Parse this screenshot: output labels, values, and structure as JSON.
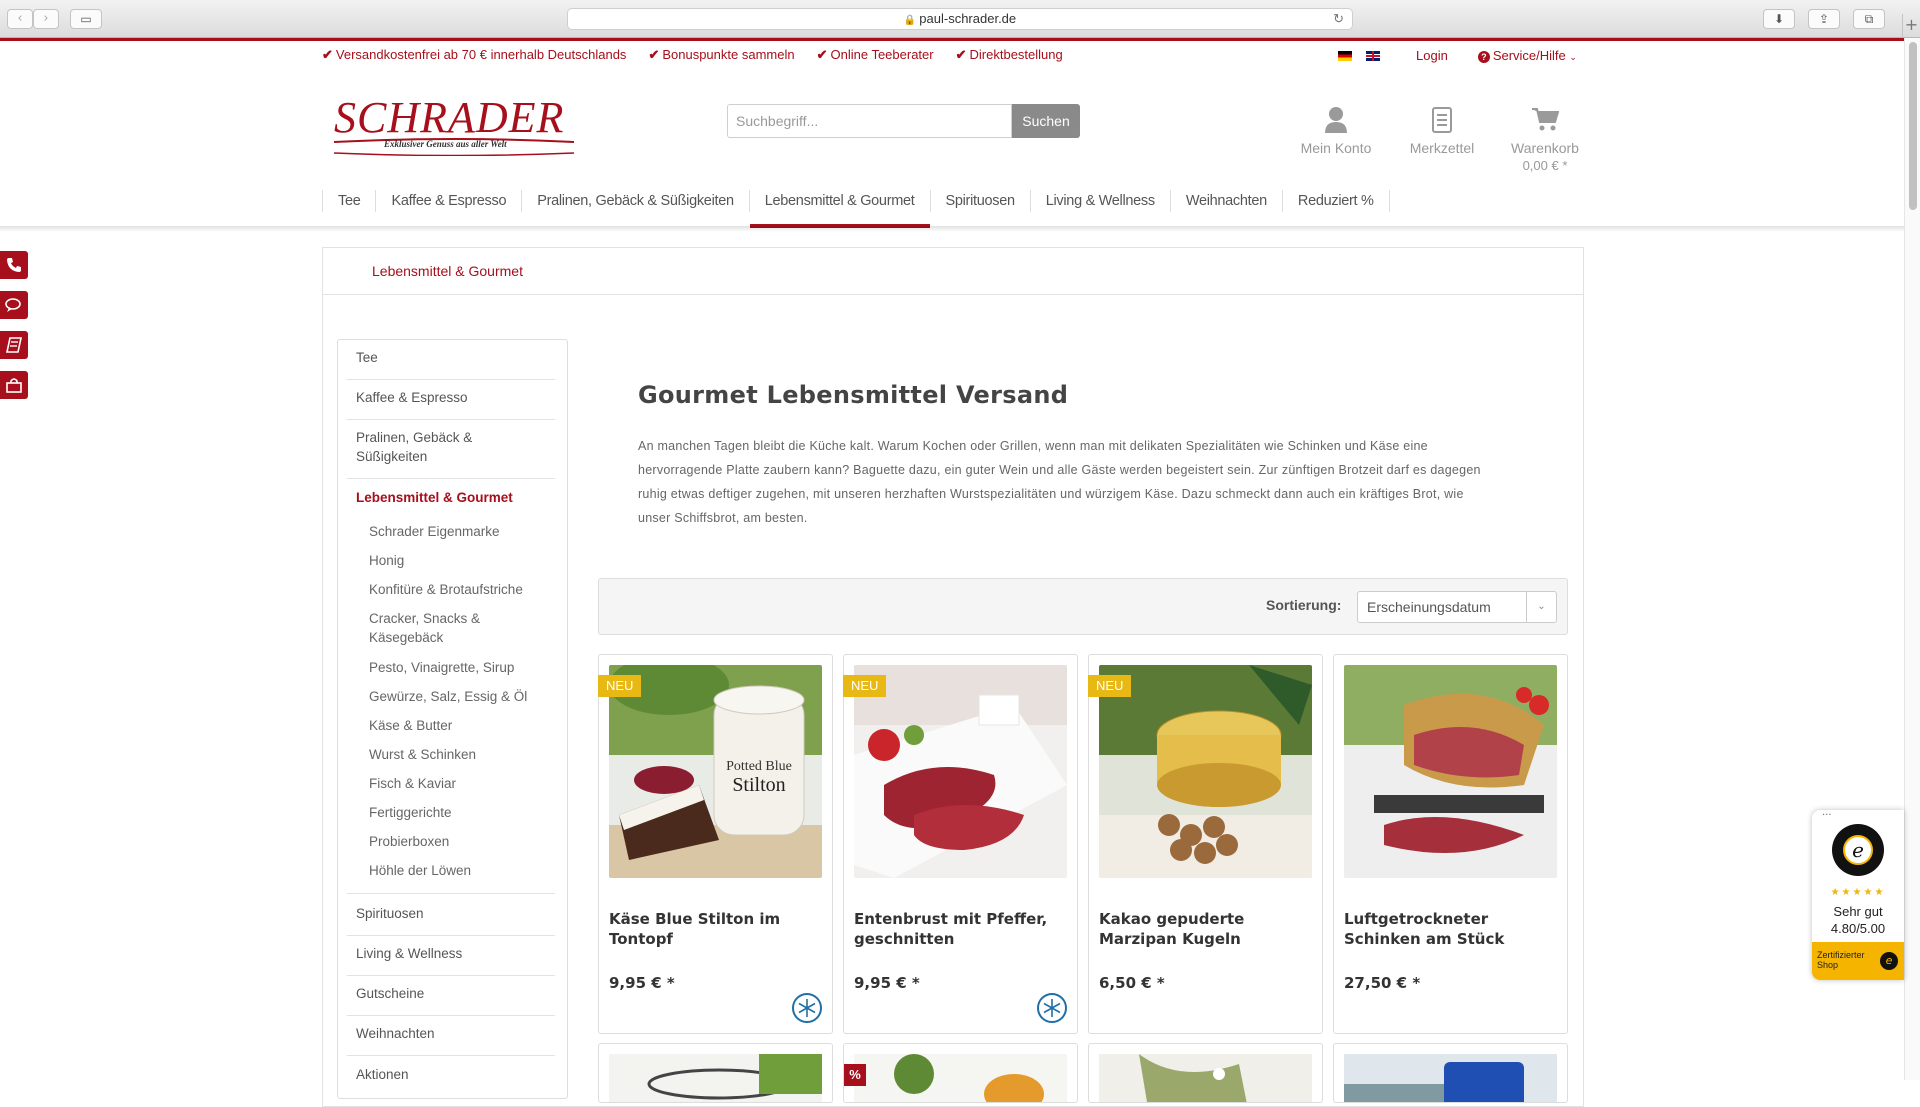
{
  "browser": {
    "url": "paul-schrader.de"
  },
  "usp": [
    "Versandkostenfrei ab 70 € innerhalb Deutschlands",
    "Bonuspunkte sammeln",
    "Online Teeberater",
    "Direktbestellung"
  ],
  "top_links": {
    "login": "Login",
    "service": "Service/Hilfe"
  },
  "logo": {
    "word": "SCHRADER",
    "tagline": "Exklusiver Genuss aus aller Welt"
  },
  "search": {
    "placeholder": "Suchbegriff...",
    "button": "Suchen"
  },
  "header_actions": {
    "account": "Mein Konto",
    "wishlist": "Merkzettel",
    "cart": "Warenkorb",
    "cart_total": "0,00 € *"
  },
  "main_nav": [
    "Tee",
    "Kaffee & Espresso",
    "Pralinen, Gebäck & Süßigkeiten",
    "Lebensmittel & Gourmet",
    "Spirituosen",
    "Living & Wellness",
    "Weihnachten",
    "Reduziert %"
  ],
  "main_nav_active": "Lebensmittel & Gourmet",
  "breadcrumb": "Lebensmittel & Gourmet",
  "sidebar": {
    "top": [
      "Tee",
      "Kaffee & Espresso",
      "Pralinen, Gebäck &",
      "Süßigkeiten"
    ],
    "active": "Lebensmittel & Gourmet",
    "sub": [
      "Schrader Eigenmarke",
      "Honig",
      "Konfitüre & Brotaufstriche",
      "Cracker, Snacks &",
      "Käsegebäck",
      "Pesto, Vinaigrette, Sirup",
      "Gewürze, Salz, Essig & Öl",
      "Käse & Butter",
      "Wurst & Schinken",
      "Fisch & Kaviar",
      "Fertiggerichte",
      "Probierboxen",
      "Höhle der Löwen"
    ],
    "bottom": [
      "Spirituosen",
      "Living & Wellness",
      "Gutscheine",
      "Weihnachten",
      "Aktionen"
    ]
  },
  "page": {
    "title": "Gourmet Lebensmittel Versand",
    "description_lines": [
      "An manchen Tagen bleibt die Küche kalt. Warum Kochen oder Grillen, wenn man mit delikaten Spezialitäten wie Schinken und Käse eine",
      "hervorragende Platte zaubern kann? Baguette dazu, ein guter Wein und alle Gäste werden begeistert sein. Zur zünftigen Brotzeit darf es dagegen",
      "ruhig etwas deftiger zugehen, mit unseren herzhaften Wurstspezialitäten und würzigem Käse. Dazu schmeckt dann auch ein kräftiges Brot, wie",
      "unser Schiffsbrot, am besten."
    ]
  },
  "sorting": {
    "label": "Sortierung:",
    "selected": "Erscheinungsdatum"
  },
  "products": [
    {
      "title_lines": [
        "Käse Blue Stilton im",
        "Tontopf"
      ],
      "price": "9,95 € *",
      "badge": "NEU",
      "frozen": true
    },
    {
      "title_lines": [
        "Entenbrust mit Pfeffer,",
        "geschnitten"
      ],
      "price": "9,95 € *",
      "badge": "NEU",
      "frozen": true
    },
    {
      "title_lines": [
        "Kakao gepuderte",
        "Marzipan Kugeln"
      ],
      "price": "6,50 € *",
      "badge": "NEU",
      "frozen": false
    },
    {
      "title_lines": [
        "Luftgetrockneter",
        "Schinken am Stück"
      ],
      "price": "27,50 € *",
      "badge": "",
      "frozen": false
    }
  ],
  "second_row_badge": "%",
  "trusted_shops": {
    "dots": "···",
    "stars": "★★★★★",
    "rating_word": "Sehr gut",
    "rating": "4.80/5.00",
    "footer_line1": "Zertifizierter",
    "footer_line2": "Shop"
  },
  "colors": {
    "brand_red": "#a60f1b",
    "badge_yellow": "#e8b814",
    "frozen_blue": "#1f6fa8"
  }
}
